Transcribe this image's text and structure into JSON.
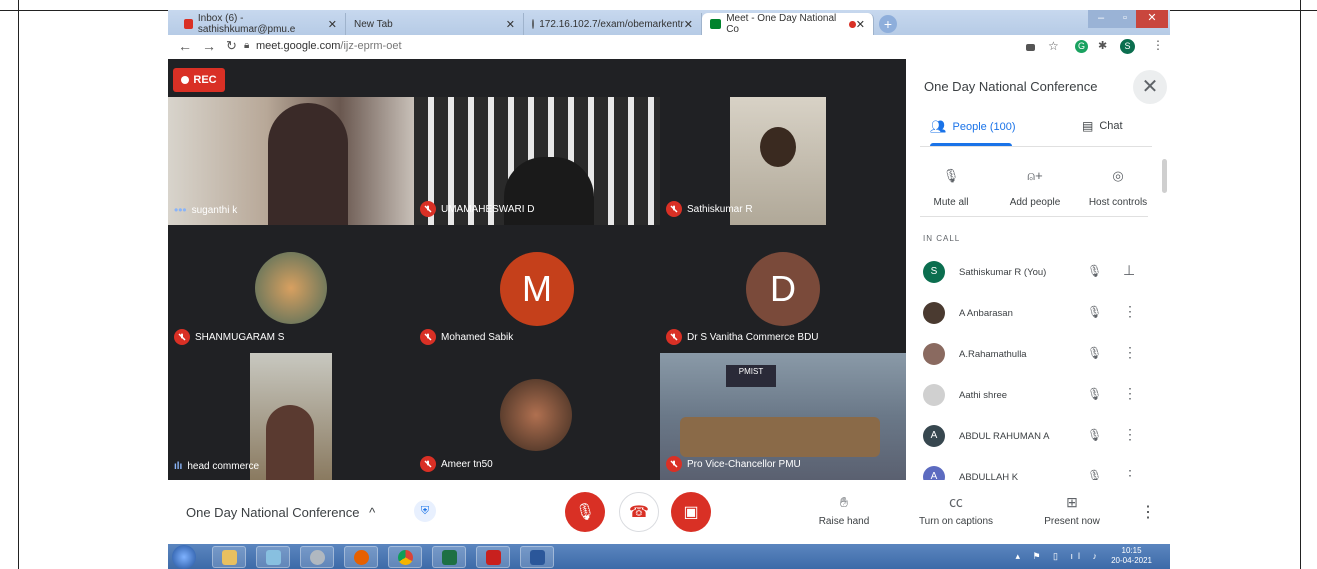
{
  "browser": {
    "tabs": [
      {
        "title": "Inbox (6) - sathishkumar@pmu.e",
        "icon_color": "#d93025"
      },
      {
        "title": "New Tab",
        "icon_color": ""
      },
      {
        "title": "172.16.102.7/exam/obemarkentr",
        "icon_color": "#5f6368"
      },
      {
        "title": "Meet - One Day National Co",
        "icon_color": "#00832d",
        "active": true
      }
    ],
    "url_host": "meet.google.com",
    "url_path": "/ijz-eprm-oet",
    "profile_initial": "S"
  },
  "meeting": {
    "rec_label": "REC",
    "title": "One Day National Conference",
    "tiles": [
      {
        "name": "suganthi k",
        "indicator": "speaking-dots",
        "bg": "#8a7a70"
      },
      {
        "name": "UMAMAHESWARI D",
        "indicator": "mic-off",
        "bg": "#3a3a3a"
      },
      {
        "name": "Sathiskumar R",
        "indicator": "mic-off",
        "bg": "#c9c2b4"
      },
      {
        "name": "SHANMUGARAM S",
        "indicator": "mic-off",
        "bg": "#202124"
      },
      {
        "name": "Mohamed Sabik",
        "indicator": "mic-off",
        "bg": "#202124",
        "avatar": "M",
        "avatar_color": "#c5401b"
      },
      {
        "name": "Dr S Vanitha Commerce BDU",
        "indicator": "mic-off",
        "bg": "#202124",
        "avatar": "D",
        "avatar_color": "#7a4a3a"
      },
      {
        "name": "head commerce",
        "indicator": "speaking-bars",
        "bg": "#202124"
      },
      {
        "name": "Ameer tn50",
        "indicator": "mic-off",
        "bg": "#202124"
      },
      {
        "name": "Pro Vice-Chancellor PMU",
        "indicator": "mic-off",
        "bg": "#6a7a8a",
        "banner": "PMIST"
      }
    ]
  },
  "panel": {
    "title": "One Day National Conference",
    "tab_people": "People (100)",
    "tab_chat": "Chat",
    "actions": [
      "Mute all",
      "Add people",
      "Host controls"
    ],
    "section_label": "IN CALL",
    "participants": [
      {
        "name": "Sathiskumar R (You)",
        "initial": "S",
        "color": "#0b6e4f",
        "trail": "pin"
      },
      {
        "name": "A Anbarasan",
        "initial": "",
        "color": "#4a3a30",
        "trail": "more"
      },
      {
        "name": "A.Rahamathulla",
        "initial": "",
        "color": "#8a6a60",
        "trail": "more"
      },
      {
        "name": "Aathi shree",
        "initial": "",
        "color": "#d0d0d0",
        "trail": "more"
      },
      {
        "name": "ABDUL RAHUMAN A",
        "initial": "A",
        "color": "#37474f",
        "trail": "more"
      },
      {
        "name": "ABDULLAH K",
        "initial": "A",
        "color": "#5c6bc0",
        "trail": "more"
      }
    ]
  },
  "bottom": {
    "raise_hand": "Raise hand",
    "captions": "Turn on captions",
    "present": "Present now"
  },
  "taskbar": {
    "time": "10:15",
    "date": "20-04-2021"
  }
}
